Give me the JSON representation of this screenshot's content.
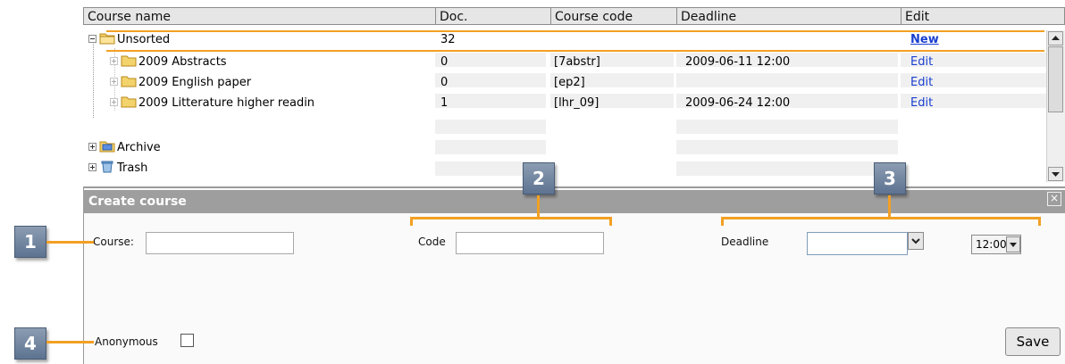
{
  "table": {
    "headers": [
      "Course name",
      "Doc.",
      "Course code",
      "Deadline",
      "Edit"
    ],
    "rows": [
      {
        "name": "Unsorted",
        "doc": "32",
        "code": "",
        "deadline": "",
        "edit": "New"
      },
      {
        "name": "2009 Abstracts",
        "doc": "0",
        "code": "[7abstr]",
        "deadline": "2009-06-11 12:00",
        "edit": "Edit"
      },
      {
        "name": "2009 English paper",
        "doc": "0",
        "code": "[ep2]",
        "deadline": "",
        "edit": "Edit"
      },
      {
        "name": "2009 Litterature higher readin",
        "doc": "1",
        "code": "[lhr_09]",
        "deadline": "2009-06-24 12:00",
        "edit": "Edit"
      }
    ],
    "folders": [
      "Archive",
      "Trash"
    ]
  },
  "create_course": {
    "title": "Create course",
    "close_glyph": "×",
    "course_label": "Course:",
    "course_value": "",
    "code_label": "Code",
    "code_value": "",
    "deadline_label": "Deadline",
    "deadline_value": "",
    "time_value": "12:00",
    "anonymous_label": "Anonymous",
    "anonymous_checked": false,
    "save_label": "Save"
  },
  "callouts": [
    "1",
    "2",
    "3",
    "4"
  ],
  "colors": {
    "accent": "#f2a024",
    "header_bar": "#9e9e9e",
    "link": "#1a3fcf",
    "badge": "#6b7f9b"
  }
}
